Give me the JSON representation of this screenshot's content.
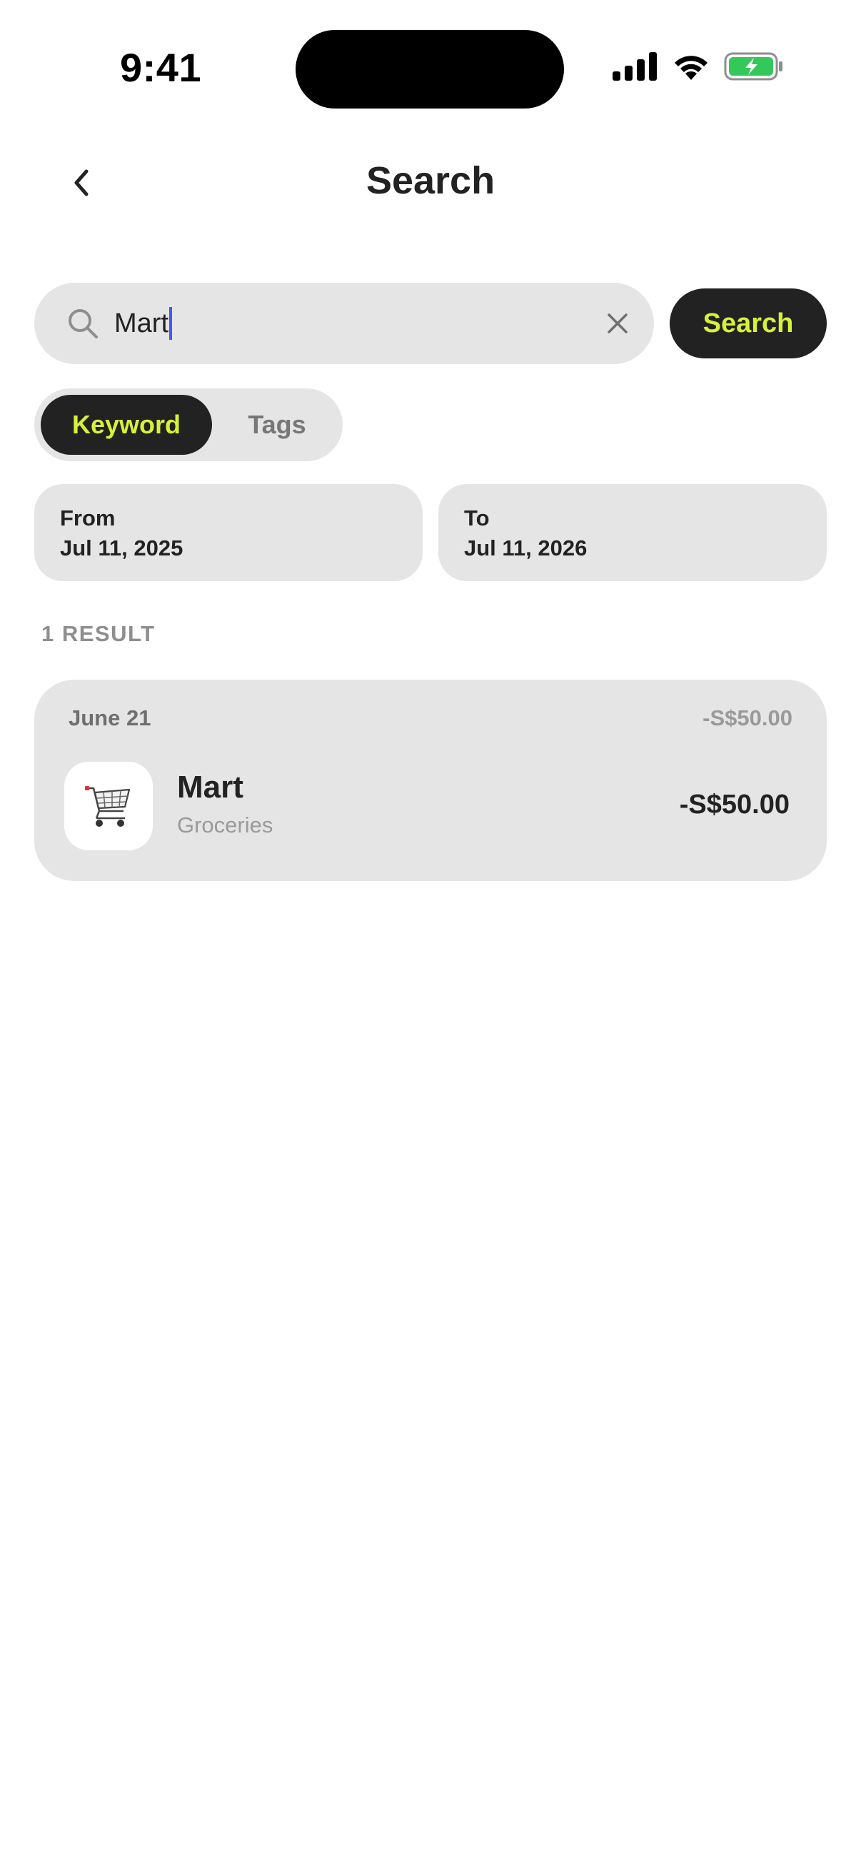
{
  "status_bar": {
    "time": "9:41",
    "icons": [
      "cellular-signal-icon",
      "wifi-icon",
      "battery-charging-icon"
    ],
    "battery_color": "#34c759"
  },
  "header": {
    "title": "Search",
    "back_icon": "chevron-left-icon"
  },
  "search": {
    "value": "Mart",
    "button_label": "Search",
    "accent_color": "#d7f13a"
  },
  "mode_toggle": {
    "options": [
      "Keyword",
      "Tags"
    ],
    "selected": "Keyword"
  },
  "date_range": {
    "from_label": "From",
    "from_value": "Jul 11, 2025",
    "to_label": "To",
    "to_value": "Jul 11, 2026"
  },
  "results": {
    "count_label": "1 RESULT",
    "groups": [
      {
        "date": "June 21",
        "total": "-S$50.00",
        "items": [
          {
            "icon": "shopping-cart-icon",
            "name": "Mart",
            "category": "Groceries",
            "amount": "-S$50.00"
          }
        ]
      }
    ]
  }
}
